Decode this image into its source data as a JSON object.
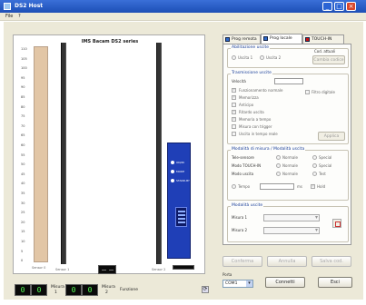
{
  "window": {
    "title": "DS2 Host",
    "minimize": "_",
    "maximize": "□",
    "close": "×"
  },
  "menu": [
    "File",
    "?"
  ],
  "chart_panel": {
    "title": "IMS Bacam DS2 series",
    "scale_labels": [
      "110",
      "105",
      "100",
      "95",
      "90",
      "85",
      "80",
      "75",
      "70",
      "65",
      "60",
      "55",
      "50",
      "45",
      "40",
      "35",
      "30",
      "25",
      "20",
      "15",
      "10",
      "5",
      "0"
    ],
    "sand_label": "Sensor 0",
    "left_column_label": "Sensor 1",
    "right_column_label": "Sensor 2"
  },
  "device": {
    "indicators": [
      "ON/IN",
      "MODE",
      "STAND-BY"
    ]
  },
  "status": {
    "lcd1": "0",
    "lcd1_label": "Misura",
    "lcd1_sub": "1",
    "lcd2": "0",
    "lcd2_label": "Misura",
    "lcd2_sub": "2",
    "function_label": "Funzione"
  },
  "tabs": [
    {
      "label": "Prog remota",
      "icon": "remote-icon"
    },
    {
      "label": "Prog locale",
      "icon": "local-icon"
    },
    {
      "label": "TOUCH-IN",
      "icon": "flag-icon"
    }
  ],
  "tab_page": {
    "group_attiva": {
      "legend": "Abilitazione uscite",
      "opt1": "Uscita 1",
      "opt2": "Uscita 2",
      "cod_label": "Cod. attuali",
      "cod_btn": "Cambia codice"
    },
    "group_trasm": {
      "legend": "Trasmissione uscite",
      "velocity_label": "Velocità",
      "items": [
        "Funzionamento normale",
        "Memorizza",
        "Anticipo",
        "Ritardo uscita",
        "Memoria a tempo",
        "Misura con trigger",
        "Uscita in tempo reale"
      ],
      "right_item": "Filtro digitale",
      "apply_btn": "Applica"
    },
    "group_modi": {
      "legend": "Modalità di misura / Modalità uscita",
      "rows": [
        {
          "label": "Tele-sensore",
          "a": "Normale",
          "b": "Special"
        },
        {
          "label": "Modo TOUCH-IN",
          "a": "Normale",
          "b": "Special"
        },
        {
          "label": "Modo uscita",
          "a": "Normale",
          "b": "Test"
        }
      ],
      "timer_label": "Tempo",
      "timer_unit": "ms",
      "timer_right": "Hold"
    },
    "group_uscite": {
      "legend": "Modalità uscite",
      "row1": "Misura 1",
      "row2": "Misura 2"
    }
  },
  "bottom_buttons": [
    "Conferma",
    "Annulla",
    "Salva cod."
  ],
  "port": {
    "label": "Porta",
    "value": "COM1"
  },
  "connect_button": "Connetti",
  "exit_button": "Esci"
}
